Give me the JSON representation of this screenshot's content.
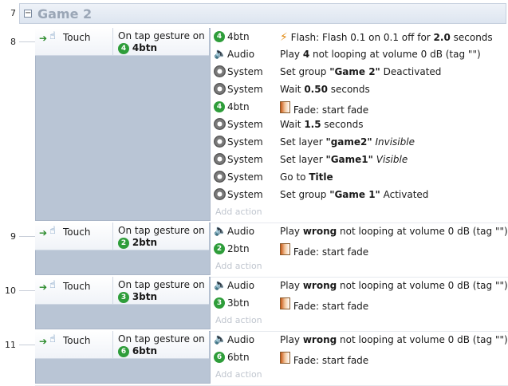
{
  "group": {
    "row": "7",
    "title": "Game 2",
    "collapse_glyph": "−"
  },
  "add_action_label": "Add action",
  "events": [
    {
      "row": "8",
      "condition": {
        "object": "Touch",
        "text": "On tap gesture on",
        "target_num": "4",
        "target": "4btn"
      },
      "actions": [
        {
          "icon": "numbadge",
          "num": "4",
          "object": "4btn",
          "parts": [
            {
              "t": "Flash: Flash 0.1 on 0.1 off for "
            },
            {
              "b": "2.0"
            },
            {
              "t": " seconds"
            }
          ],
          "icon_kind": "flash"
        },
        {
          "icon": "speaker",
          "object": "Audio",
          "parts": [
            {
              "t": "Play "
            },
            {
              "b": "4"
            },
            {
              "t": " not looping at volume 0 dB (tag \"\")"
            }
          ]
        },
        {
          "icon": "gear",
          "object": "System",
          "parts": [
            {
              "t": "Set group "
            },
            {
              "b": "\"Game 2\""
            },
            {
              "t": " Deactivated"
            }
          ]
        },
        {
          "icon": "gear",
          "object": "System",
          "parts": [
            {
              "t": "Wait "
            },
            {
              "b": "0.50"
            },
            {
              "t": " seconds"
            }
          ]
        },
        {
          "icon": "numbadge",
          "num": "4",
          "object": "4btn",
          "parts": [
            {
              "t": "Fade: start fade"
            }
          ],
          "icon_kind": "fade"
        },
        {
          "icon": "gear",
          "object": "System",
          "parts": [
            {
              "t": "Wait "
            },
            {
              "b": "1.5"
            },
            {
              "t": " seconds"
            }
          ]
        },
        {
          "icon": "gear",
          "object": "System",
          "parts": [
            {
              "t": "Set layer "
            },
            {
              "b": "\"game2\""
            },
            {
              "t": " "
            },
            {
              "i": "Invisible"
            }
          ]
        },
        {
          "icon": "gear",
          "object": "System",
          "parts": [
            {
              "t": "Set layer "
            },
            {
              "b": "\"Game1\""
            },
            {
              "t": " "
            },
            {
              "i": "Visible"
            }
          ]
        },
        {
          "icon": "gear",
          "object": "System",
          "parts": [
            {
              "t": "Go to "
            },
            {
              "b": "Title"
            }
          ]
        },
        {
          "icon": "gear",
          "object": "System",
          "parts": [
            {
              "t": "Set group "
            },
            {
              "b": "\"Game 1\""
            },
            {
              "t": " Activated"
            }
          ]
        }
      ]
    },
    {
      "row": "9",
      "condition": {
        "object": "Touch",
        "text": "On tap gesture on",
        "target_num": "2",
        "target": "2btn"
      },
      "actions": [
        {
          "icon": "speaker",
          "object": "Audio",
          "parts": [
            {
              "t": "Play "
            },
            {
              "b": "wrong"
            },
            {
              "t": " not looping at volume 0 dB (tag \"\")"
            }
          ]
        },
        {
          "icon": "numbadge",
          "num": "2",
          "object": "2btn",
          "parts": [
            {
              "t": "Fade: start fade"
            }
          ],
          "icon_kind": "fade"
        }
      ]
    },
    {
      "row": "10",
      "condition": {
        "object": "Touch",
        "text": "On tap gesture on",
        "target_num": "3",
        "target": "3btn"
      },
      "actions": [
        {
          "icon": "speaker",
          "object": "Audio",
          "parts": [
            {
              "t": "Play "
            },
            {
              "b": "wrong"
            },
            {
              "t": " not looping at volume 0 dB (tag \"\")"
            }
          ]
        },
        {
          "icon": "numbadge",
          "num": "3",
          "object": "3btn",
          "parts": [
            {
              "t": "Fade: start fade"
            }
          ],
          "icon_kind": "fade"
        }
      ]
    },
    {
      "row": "11",
      "condition": {
        "object": "Touch",
        "text": "On tap gesture on",
        "target_num": "6",
        "target": "6btn"
      },
      "actions": [
        {
          "icon": "speaker",
          "object": "Audio",
          "parts": [
            {
              "t": "Play "
            },
            {
              "b": "wrong"
            },
            {
              "t": " not looping at volume 0 dB (tag \"\")"
            }
          ]
        },
        {
          "icon": "numbadge",
          "num": "6",
          "object": "6btn",
          "parts": [
            {
              "t": "Fade: start fade"
            }
          ],
          "icon_kind": "fade"
        }
      ]
    }
  ]
}
